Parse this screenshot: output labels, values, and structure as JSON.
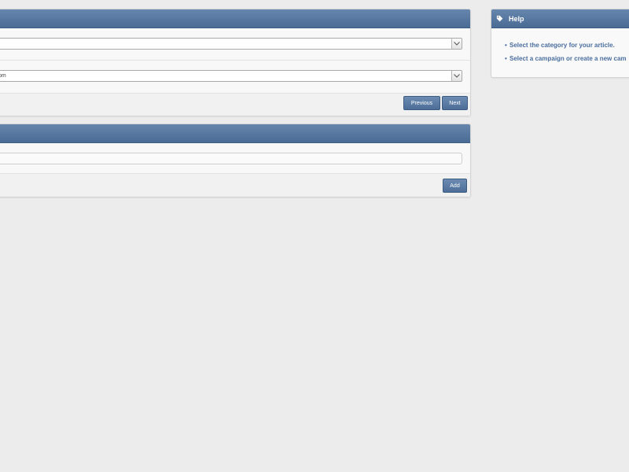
{
  "wizard": {
    "category_select_value": "",
    "campaign_select_value": "om",
    "previous_label": "Previous",
    "next_label": "Next"
  },
  "add_panel": {
    "input_value": "",
    "add_label": "Add"
  },
  "help": {
    "title": "Help",
    "items": [
      "Select the category for your article.",
      "Select a campaign or create a new cam"
    ]
  },
  "colors": {
    "header": "#4a6b94",
    "button": "#5676a0",
    "link": "#4a6e9e",
    "background": "#ececec"
  },
  "icons": {
    "help": "tag-icon",
    "select": "chevron-down-icon"
  }
}
